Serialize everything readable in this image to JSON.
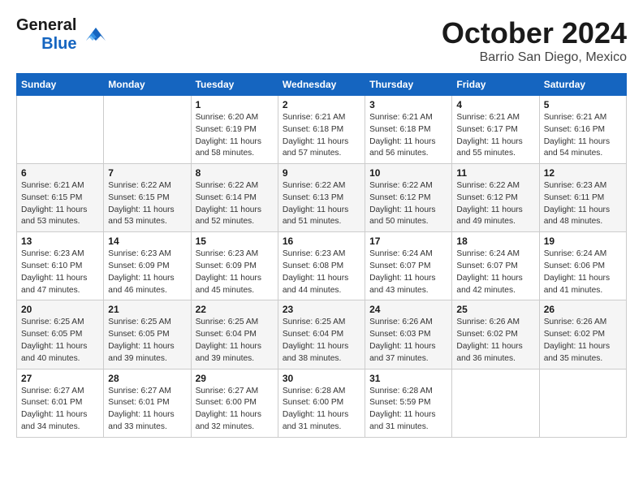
{
  "logo": {
    "line1": "General",
    "line2": "Blue"
  },
  "title": "October 2024",
  "subtitle": "Barrio San Diego, Mexico",
  "days_of_week": [
    "Sunday",
    "Monday",
    "Tuesday",
    "Wednesday",
    "Thursday",
    "Friday",
    "Saturday"
  ],
  "weeks": [
    [
      {
        "num": "",
        "info": ""
      },
      {
        "num": "",
        "info": ""
      },
      {
        "num": "1",
        "info": "Sunrise: 6:20 AM\nSunset: 6:19 PM\nDaylight: 11 hours and 58 minutes."
      },
      {
        "num": "2",
        "info": "Sunrise: 6:21 AM\nSunset: 6:18 PM\nDaylight: 11 hours and 57 minutes."
      },
      {
        "num": "3",
        "info": "Sunrise: 6:21 AM\nSunset: 6:18 PM\nDaylight: 11 hours and 56 minutes."
      },
      {
        "num": "4",
        "info": "Sunrise: 6:21 AM\nSunset: 6:17 PM\nDaylight: 11 hours and 55 minutes."
      },
      {
        "num": "5",
        "info": "Sunrise: 6:21 AM\nSunset: 6:16 PM\nDaylight: 11 hours and 54 minutes."
      }
    ],
    [
      {
        "num": "6",
        "info": "Sunrise: 6:21 AM\nSunset: 6:15 PM\nDaylight: 11 hours and 53 minutes."
      },
      {
        "num": "7",
        "info": "Sunrise: 6:22 AM\nSunset: 6:15 PM\nDaylight: 11 hours and 53 minutes."
      },
      {
        "num": "8",
        "info": "Sunrise: 6:22 AM\nSunset: 6:14 PM\nDaylight: 11 hours and 52 minutes."
      },
      {
        "num": "9",
        "info": "Sunrise: 6:22 AM\nSunset: 6:13 PM\nDaylight: 11 hours and 51 minutes."
      },
      {
        "num": "10",
        "info": "Sunrise: 6:22 AM\nSunset: 6:12 PM\nDaylight: 11 hours and 50 minutes."
      },
      {
        "num": "11",
        "info": "Sunrise: 6:22 AM\nSunset: 6:12 PM\nDaylight: 11 hours and 49 minutes."
      },
      {
        "num": "12",
        "info": "Sunrise: 6:23 AM\nSunset: 6:11 PM\nDaylight: 11 hours and 48 minutes."
      }
    ],
    [
      {
        "num": "13",
        "info": "Sunrise: 6:23 AM\nSunset: 6:10 PM\nDaylight: 11 hours and 47 minutes."
      },
      {
        "num": "14",
        "info": "Sunrise: 6:23 AM\nSunset: 6:09 PM\nDaylight: 11 hours and 46 minutes."
      },
      {
        "num": "15",
        "info": "Sunrise: 6:23 AM\nSunset: 6:09 PM\nDaylight: 11 hours and 45 minutes."
      },
      {
        "num": "16",
        "info": "Sunrise: 6:23 AM\nSunset: 6:08 PM\nDaylight: 11 hours and 44 minutes."
      },
      {
        "num": "17",
        "info": "Sunrise: 6:24 AM\nSunset: 6:07 PM\nDaylight: 11 hours and 43 minutes."
      },
      {
        "num": "18",
        "info": "Sunrise: 6:24 AM\nSunset: 6:07 PM\nDaylight: 11 hours and 42 minutes."
      },
      {
        "num": "19",
        "info": "Sunrise: 6:24 AM\nSunset: 6:06 PM\nDaylight: 11 hours and 41 minutes."
      }
    ],
    [
      {
        "num": "20",
        "info": "Sunrise: 6:25 AM\nSunset: 6:05 PM\nDaylight: 11 hours and 40 minutes."
      },
      {
        "num": "21",
        "info": "Sunrise: 6:25 AM\nSunset: 6:05 PM\nDaylight: 11 hours and 39 minutes."
      },
      {
        "num": "22",
        "info": "Sunrise: 6:25 AM\nSunset: 6:04 PM\nDaylight: 11 hours and 39 minutes."
      },
      {
        "num": "23",
        "info": "Sunrise: 6:25 AM\nSunset: 6:04 PM\nDaylight: 11 hours and 38 minutes."
      },
      {
        "num": "24",
        "info": "Sunrise: 6:26 AM\nSunset: 6:03 PM\nDaylight: 11 hours and 37 minutes."
      },
      {
        "num": "25",
        "info": "Sunrise: 6:26 AM\nSunset: 6:02 PM\nDaylight: 11 hours and 36 minutes."
      },
      {
        "num": "26",
        "info": "Sunrise: 6:26 AM\nSunset: 6:02 PM\nDaylight: 11 hours and 35 minutes."
      }
    ],
    [
      {
        "num": "27",
        "info": "Sunrise: 6:27 AM\nSunset: 6:01 PM\nDaylight: 11 hours and 34 minutes."
      },
      {
        "num": "28",
        "info": "Sunrise: 6:27 AM\nSunset: 6:01 PM\nDaylight: 11 hours and 33 minutes."
      },
      {
        "num": "29",
        "info": "Sunrise: 6:27 AM\nSunset: 6:00 PM\nDaylight: 11 hours and 32 minutes."
      },
      {
        "num": "30",
        "info": "Sunrise: 6:28 AM\nSunset: 6:00 PM\nDaylight: 11 hours and 31 minutes."
      },
      {
        "num": "31",
        "info": "Sunrise: 6:28 AM\nSunset: 5:59 PM\nDaylight: 11 hours and 31 minutes."
      },
      {
        "num": "",
        "info": ""
      },
      {
        "num": "",
        "info": ""
      }
    ]
  ]
}
